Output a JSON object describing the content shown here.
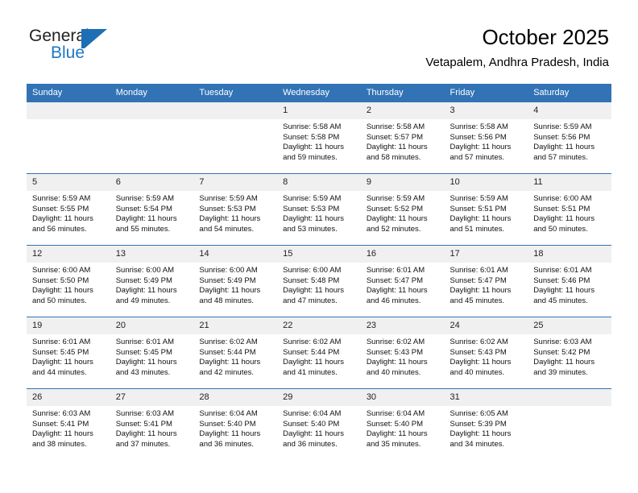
{
  "brand": {
    "name_part1": "General",
    "name_part2": "Blue",
    "mark_icon": "triangle-flag-icon",
    "accent_color": "#1c6fb5"
  },
  "header": {
    "title": "October 2025",
    "subtitle": "Vetapalem, Andhra Pradesh, India"
  },
  "theme": {
    "header_row_bg": "#3273b5",
    "date_band_bg": "#f0f0f0",
    "grid_line": "#3273b5"
  },
  "weekdays": [
    "Sunday",
    "Monday",
    "Tuesday",
    "Wednesday",
    "Thursday",
    "Friday",
    "Saturday"
  ],
  "labels": {
    "sunrise_prefix": "Sunrise:",
    "sunset_prefix": "Sunset:",
    "daylight_prefix": "Daylight:"
  },
  "weeks": [
    [
      {
        "day": "",
        "empty": true
      },
      {
        "day": "",
        "empty": true
      },
      {
        "day": "",
        "empty": true
      },
      {
        "day": "1",
        "sunrise": "Sunrise: 5:58 AM",
        "sunset": "Sunset: 5:58 PM",
        "daylight_line1": "Daylight: 11 hours",
        "daylight_line2": "and 59 minutes."
      },
      {
        "day": "2",
        "sunrise": "Sunrise: 5:58 AM",
        "sunset": "Sunset: 5:57 PM",
        "daylight_line1": "Daylight: 11 hours",
        "daylight_line2": "and 58 minutes."
      },
      {
        "day": "3",
        "sunrise": "Sunrise: 5:58 AM",
        "sunset": "Sunset: 5:56 PM",
        "daylight_line1": "Daylight: 11 hours",
        "daylight_line2": "and 57 minutes."
      },
      {
        "day": "4",
        "sunrise": "Sunrise: 5:59 AM",
        "sunset": "Sunset: 5:56 PM",
        "daylight_line1": "Daylight: 11 hours",
        "daylight_line2": "and 57 minutes."
      }
    ],
    [
      {
        "day": "5",
        "sunrise": "Sunrise: 5:59 AM",
        "sunset": "Sunset: 5:55 PM",
        "daylight_line1": "Daylight: 11 hours",
        "daylight_line2": "and 56 minutes."
      },
      {
        "day": "6",
        "sunrise": "Sunrise: 5:59 AM",
        "sunset": "Sunset: 5:54 PM",
        "daylight_line1": "Daylight: 11 hours",
        "daylight_line2": "and 55 minutes."
      },
      {
        "day": "7",
        "sunrise": "Sunrise: 5:59 AM",
        "sunset": "Sunset: 5:53 PM",
        "daylight_line1": "Daylight: 11 hours",
        "daylight_line2": "and 54 minutes."
      },
      {
        "day": "8",
        "sunrise": "Sunrise: 5:59 AM",
        "sunset": "Sunset: 5:53 PM",
        "daylight_line1": "Daylight: 11 hours",
        "daylight_line2": "and 53 minutes."
      },
      {
        "day": "9",
        "sunrise": "Sunrise: 5:59 AM",
        "sunset": "Sunset: 5:52 PM",
        "daylight_line1": "Daylight: 11 hours",
        "daylight_line2": "and 52 minutes."
      },
      {
        "day": "10",
        "sunrise": "Sunrise: 5:59 AM",
        "sunset": "Sunset: 5:51 PM",
        "daylight_line1": "Daylight: 11 hours",
        "daylight_line2": "and 51 minutes."
      },
      {
        "day": "11",
        "sunrise": "Sunrise: 6:00 AM",
        "sunset": "Sunset: 5:51 PM",
        "daylight_line1": "Daylight: 11 hours",
        "daylight_line2": "and 50 minutes."
      }
    ],
    [
      {
        "day": "12",
        "sunrise": "Sunrise: 6:00 AM",
        "sunset": "Sunset: 5:50 PM",
        "daylight_line1": "Daylight: 11 hours",
        "daylight_line2": "and 50 minutes."
      },
      {
        "day": "13",
        "sunrise": "Sunrise: 6:00 AM",
        "sunset": "Sunset: 5:49 PM",
        "daylight_line1": "Daylight: 11 hours",
        "daylight_line2": "and 49 minutes."
      },
      {
        "day": "14",
        "sunrise": "Sunrise: 6:00 AM",
        "sunset": "Sunset: 5:49 PM",
        "daylight_line1": "Daylight: 11 hours",
        "daylight_line2": "and 48 minutes."
      },
      {
        "day": "15",
        "sunrise": "Sunrise: 6:00 AM",
        "sunset": "Sunset: 5:48 PM",
        "daylight_line1": "Daylight: 11 hours",
        "daylight_line2": "and 47 minutes."
      },
      {
        "day": "16",
        "sunrise": "Sunrise: 6:01 AM",
        "sunset": "Sunset: 5:47 PM",
        "daylight_line1": "Daylight: 11 hours",
        "daylight_line2": "and 46 minutes."
      },
      {
        "day": "17",
        "sunrise": "Sunrise: 6:01 AM",
        "sunset": "Sunset: 5:47 PM",
        "daylight_line1": "Daylight: 11 hours",
        "daylight_line2": "and 45 minutes."
      },
      {
        "day": "18",
        "sunrise": "Sunrise: 6:01 AM",
        "sunset": "Sunset: 5:46 PM",
        "daylight_line1": "Daylight: 11 hours",
        "daylight_line2": "and 45 minutes."
      }
    ],
    [
      {
        "day": "19",
        "sunrise": "Sunrise: 6:01 AM",
        "sunset": "Sunset: 5:45 PM",
        "daylight_line1": "Daylight: 11 hours",
        "daylight_line2": "and 44 minutes."
      },
      {
        "day": "20",
        "sunrise": "Sunrise: 6:01 AM",
        "sunset": "Sunset: 5:45 PM",
        "daylight_line1": "Daylight: 11 hours",
        "daylight_line2": "and 43 minutes."
      },
      {
        "day": "21",
        "sunrise": "Sunrise: 6:02 AM",
        "sunset": "Sunset: 5:44 PM",
        "daylight_line1": "Daylight: 11 hours",
        "daylight_line2": "and 42 minutes."
      },
      {
        "day": "22",
        "sunrise": "Sunrise: 6:02 AM",
        "sunset": "Sunset: 5:44 PM",
        "daylight_line1": "Daylight: 11 hours",
        "daylight_line2": "and 41 minutes."
      },
      {
        "day": "23",
        "sunrise": "Sunrise: 6:02 AM",
        "sunset": "Sunset: 5:43 PM",
        "daylight_line1": "Daylight: 11 hours",
        "daylight_line2": "and 40 minutes."
      },
      {
        "day": "24",
        "sunrise": "Sunrise: 6:02 AM",
        "sunset": "Sunset: 5:43 PM",
        "daylight_line1": "Daylight: 11 hours",
        "daylight_line2": "and 40 minutes."
      },
      {
        "day": "25",
        "sunrise": "Sunrise: 6:03 AM",
        "sunset": "Sunset: 5:42 PM",
        "daylight_line1": "Daylight: 11 hours",
        "daylight_line2": "and 39 minutes."
      }
    ],
    [
      {
        "day": "26",
        "sunrise": "Sunrise: 6:03 AM",
        "sunset": "Sunset: 5:41 PM",
        "daylight_line1": "Daylight: 11 hours",
        "daylight_line2": "and 38 minutes."
      },
      {
        "day": "27",
        "sunrise": "Sunrise: 6:03 AM",
        "sunset": "Sunset: 5:41 PM",
        "daylight_line1": "Daylight: 11 hours",
        "daylight_line2": "and 37 minutes."
      },
      {
        "day": "28",
        "sunrise": "Sunrise: 6:04 AM",
        "sunset": "Sunset: 5:40 PM",
        "daylight_line1": "Daylight: 11 hours",
        "daylight_line2": "and 36 minutes."
      },
      {
        "day": "29",
        "sunrise": "Sunrise: 6:04 AM",
        "sunset": "Sunset: 5:40 PM",
        "daylight_line1": "Daylight: 11 hours",
        "daylight_line2": "and 36 minutes."
      },
      {
        "day": "30",
        "sunrise": "Sunrise: 6:04 AM",
        "sunset": "Sunset: 5:40 PM",
        "daylight_line1": "Daylight: 11 hours",
        "daylight_line2": "and 35 minutes."
      },
      {
        "day": "31",
        "sunrise": "Sunrise: 6:05 AM",
        "sunset": "Sunset: 5:39 PM",
        "daylight_line1": "Daylight: 11 hours",
        "daylight_line2": "and 34 minutes."
      },
      {
        "day": "",
        "empty": true
      }
    ]
  ]
}
